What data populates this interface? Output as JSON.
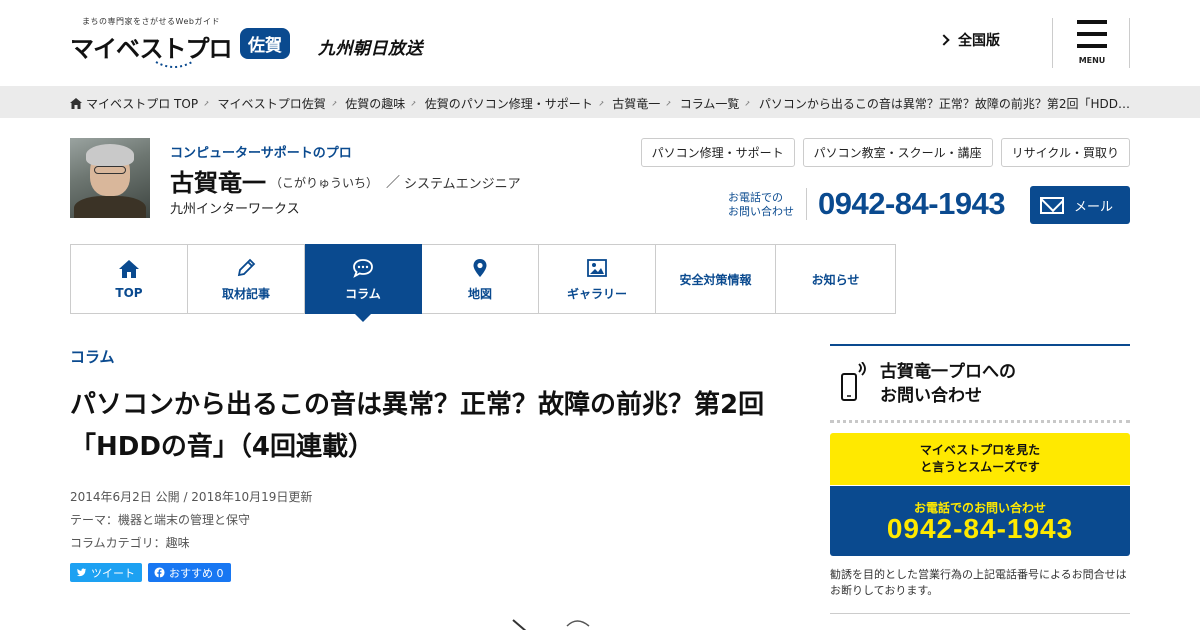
{
  "header": {
    "tagline": "まちの専門家をさがせるWebガイド",
    "logo": "マイベストプロ",
    "region": "佐賀",
    "broadcaster": "九州朝日放送",
    "nation_link": "全国版",
    "menu_label": "MENU"
  },
  "breadcrumb": [
    "マイベストプロ TOP",
    "マイベストプロ佐賀",
    "佐賀の趣味",
    "佐賀のパソコン修理・サポート",
    "古賀竜一",
    "コラム一覧",
    "パソコンから出るこの音は異常？正常？故障の前兆？第2回「HDD…"
  ],
  "profile": {
    "category": "コンピューターサポートのプロ",
    "name": "古賀竜一",
    "reading": "（こがりゅういち）",
    "separator": "／",
    "title": "システムエンジニア",
    "company": "九州インターワークス",
    "tags": [
      "パソコン修理・サポート",
      "パソコン教室・スクール・講座",
      "リサイクル・買取り"
    ],
    "phone_label": "お電話での\nお問い合わせ",
    "phone": "0942-84-1943",
    "mail_label": "メール"
  },
  "nav": [
    {
      "label": "TOP",
      "icon": "home-icon",
      "active": false
    },
    {
      "label": "取材記事",
      "icon": "pencil-icon",
      "active": false
    },
    {
      "label": "コラム",
      "icon": "chat-bubble-icon",
      "active": true
    },
    {
      "label": "地図",
      "icon": "map-pin-icon",
      "active": false
    },
    {
      "label": "ギャラリー",
      "icon": "gallery-icon",
      "active": false
    },
    {
      "label": "安全対策情報",
      "icon": "",
      "active": false
    },
    {
      "label": "お知らせ",
      "icon": "",
      "active": false
    }
  ],
  "article": {
    "section": "コラム",
    "title": "パソコンから出るこの音は異常？正常？故障の前兆？第2回「HDDの音」（4回連載）",
    "dates": "2014年6月2日 公開 / 2018年10月19日更新",
    "theme": "テーマ：機器と端末の管理と保守",
    "category": "コラムカテゴリ：趣味",
    "tweet_label": "ツイート",
    "fb_label": "おすすめ 0"
  },
  "sidebar": {
    "heading": "古賀竜一プロへの\nお問い合わせ",
    "yellow_text": "マイベストプロを見た\nと言うとスムーズです",
    "phone_label": "お電話でのお問い合わせ",
    "phone": "0942-84-1943",
    "note": "勧誘を目的とした営業行為の上記電話番号によるお問合せはお断りしております。"
  },
  "colors": {
    "brand_blue": "#0a4a8f",
    "accent_yellow": "#ffe900",
    "twitter": "#1da1f2",
    "facebook": "#1877f2"
  }
}
